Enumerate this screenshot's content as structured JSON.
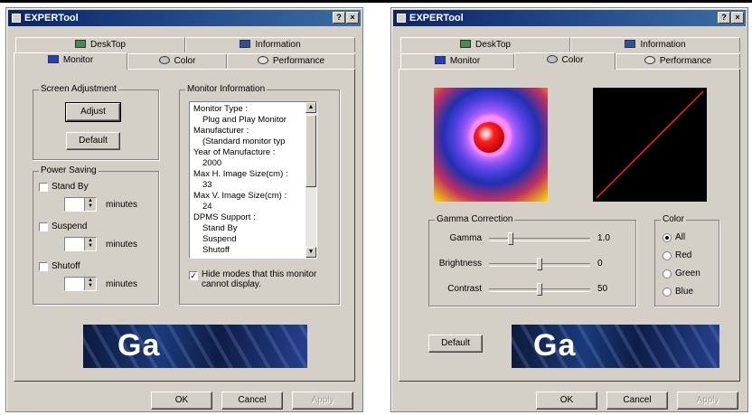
{
  "left_window": {
    "title": "EXPERTool",
    "help_btn": "?",
    "close_btn": "×",
    "tabs": [
      "DeskTop",
      "Information",
      "Monitor",
      "Color",
      "Performance"
    ],
    "active_tab": "Monitor",
    "screen_adjustment": {
      "label": "Screen Adjustment",
      "adjust_label": "Adjust",
      "default_label": "Default"
    },
    "power_saving": {
      "label": "Power Saving",
      "items": [
        {
          "label": "Stand By",
          "unit": "minutes"
        },
        {
          "label": "Suspend",
          "unit": "minutes"
        },
        {
          "label": "Shutoff",
          "unit": "minutes"
        }
      ]
    },
    "monitor_info": {
      "label": "Monitor Information",
      "lines": [
        "Monitor Type :",
        "   Plug and Play Monitor",
        "Manufacturer :",
        "   (Standard monitor typ",
        "Year of Manufacture :",
        "   2000",
        "Max H. Image Size(cm) :",
        "   33",
        "Max V. Image Size(cm) :",
        "   24",
        "DPMS Support :",
        "   Stand By",
        "   Suspend",
        "   Shutoff"
      ],
      "hide_modes_label": "Hide modes that this monitor cannot display.",
      "hide_modes_checked": true
    },
    "banner_text": "Ga",
    "ok_label": "OK",
    "cancel_label": "Cancel",
    "apply_label": "Apply"
  },
  "right_window": {
    "title": "EXPERTool",
    "help_btn": "?",
    "close_btn": "×",
    "tabs": [
      "DeskTop",
      "Information",
      "Monitor",
      "Color",
      "Performance"
    ],
    "active_tab": "Color",
    "gamma_correction": {
      "label": "Gamma Correction",
      "sliders": [
        {
          "label": "Gamma",
          "value": "1.0",
          "level": 0.2
        },
        {
          "label": "Brightness",
          "value": "0",
          "level": 0.5
        },
        {
          "label": "Contrast",
          "value": "50",
          "level": 0.5
        }
      ]
    },
    "color_group": {
      "label": "Color",
      "options": [
        "All",
        "Red",
        "Green",
        "Blue"
      ],
      "selected": "All"
    },
    "default_label": "Default",
    "banner_text": "Ga",
    "ok_label": "OK",
    "cancel_label": "Cancel",
    "apply_label": "Apply",
    "curve_color": "#ff2020"
  }
}
